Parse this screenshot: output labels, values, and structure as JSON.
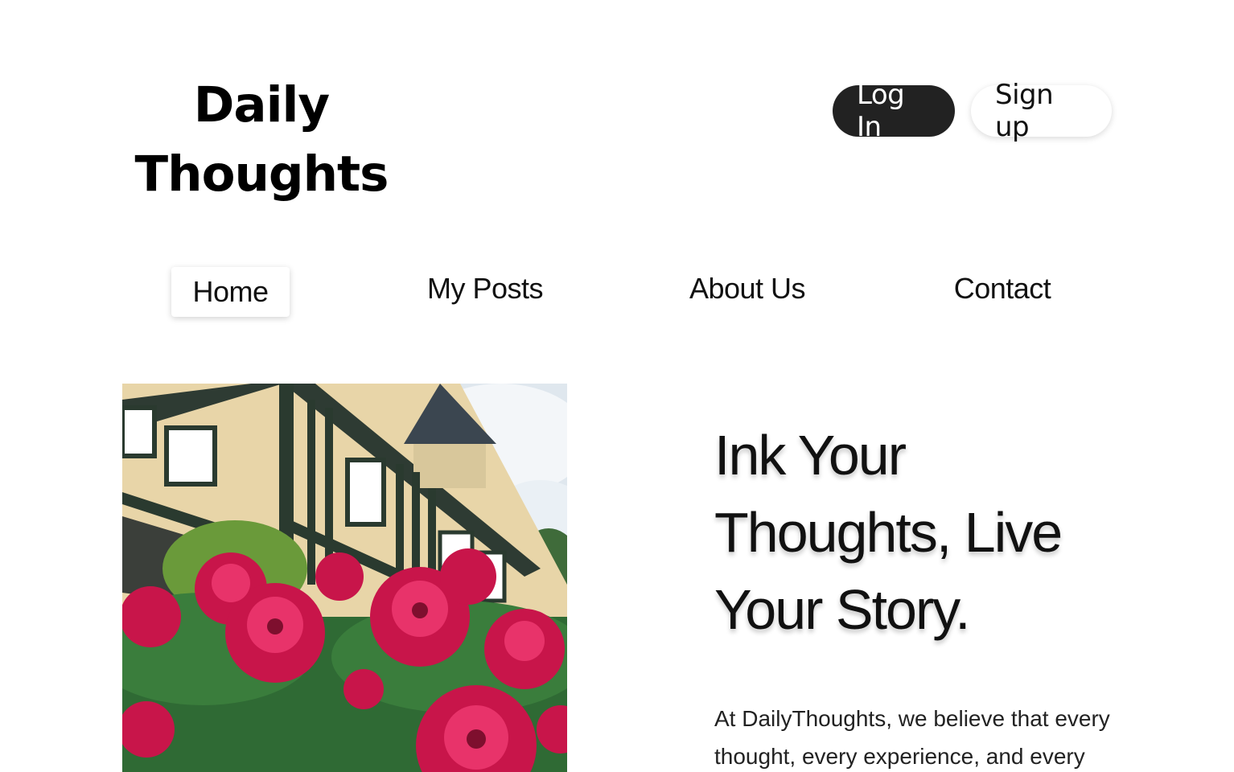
{
  "brand": {
    "line1": "Daily",
    "line2": "Thoughts"
  },
  "auth": {
    "login_label": "Log In",
    "signup_label": "Sign up"
  },
  "nav": {
    "items": [
      {
        "label": "Home",
        "active": true
      },
      {
        "label": "My Posts",
        "active": false
      },
      {
        "label": "About Us",
        "active": false
      },
      {
        "label": "Contact",
        "active": false
      }
    ]
  },
  "hero": {
    "title": "Ink Your Thoughts, Live Your Story.",
    "body": "At DailyThoughts, we believe that every thought, every experience, and every",
    "image_description_icon": "house-flowers-photo"
  },
  "colors": {
    "primary_button_bg": "#222222",
    "primary_button_text": "#ffffff",
    "page_bg": "#ffffff",
    "flower_accent": "#c8154a"
  }
}
